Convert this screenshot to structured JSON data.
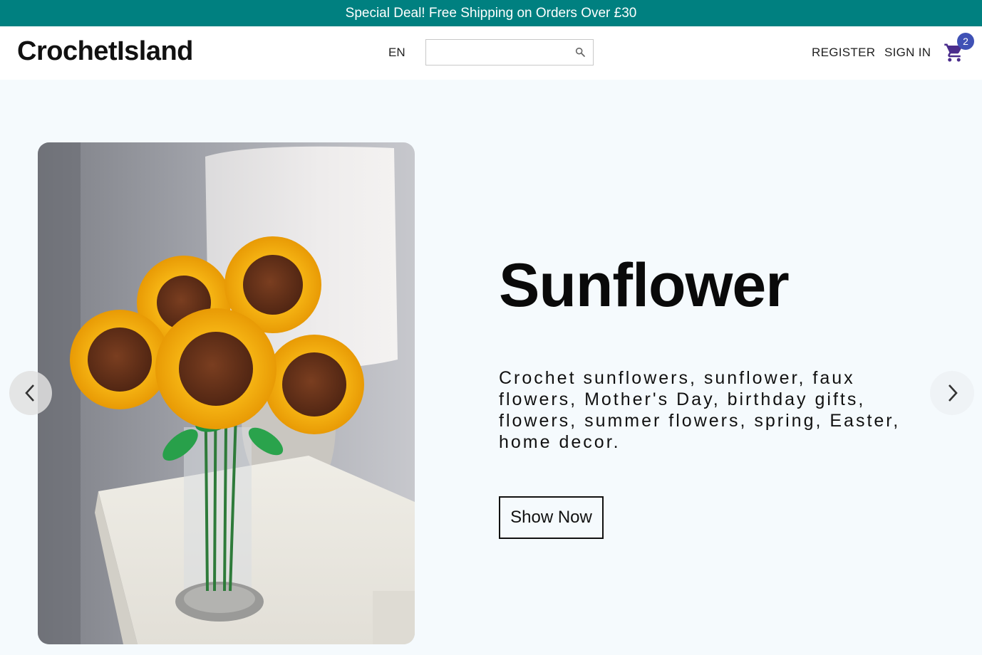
{
  "announcement": "Special Deal! Free Shipping on Orders Over £30",
  "header": {
    "logo": "CrochetIsland",
    "language": "EN",
    "search_placeholder": "",
    "register": "REGISTER",
    "sign_in": "SIGN IN",
    "cart_count": "2"
  },
  "hero": {
    "title": "Sunflower",
    "description": "Crochet sunflowers, sunflower, faux flowers, Mother's Day, birthday gifts, flowers, summer flowers, spring, Easter, home decor.",
    "button": "Show Now"
  },
  "colors": {
    "announcement_bg": "#008080",
    "cart_badge": "#3f51b5",
    "cart_icon": "#4a2c8c",
    "hero_bg": "#f5fafd"
  },
  "icons": [
    "search-icon",
    "shopping-cart-icon",
    "chevron-left-icon",
    "chevron-right-icon"
  ]
}
